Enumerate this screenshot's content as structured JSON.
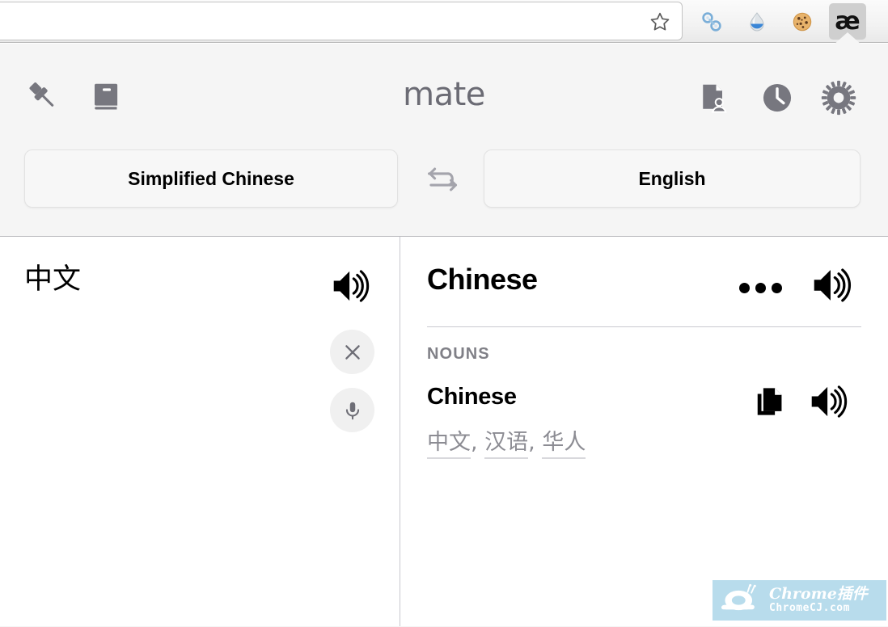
{
  "browser": {
    "omnibox": {
      "value": "",
      "placeholder": ""
    },
    "bookmark_icon": "star-icon",
    "extensions": [
      {
        "name": "link-extension-icon",
        "title": ""
      },
      {
        "name": "water-drop-extension-icon",
        "title": ""
      },
      {
        "name": "cookie-extension-icon",
        "title": ""
      },
      {
        "name": "mate-extension-icon",
        "title": "æ",
        "active": true
      }
    ]
  },
  "popup": {
    "brand": "mate",
    "left_icons": [
      {
        "name": "pin-icon"
      },
      {
        "name": "dictionary-book-icon"
      }
    ],
    "right_icons": [
      {
        "name": "document-person-icon"
      },
      {
        "name": "history-clock-icon"
      },
      {
        "name": "settings-gear-icon"
      }
    ],
    "languages": {
      "source": "Simplified Chinese",
      "target": "English",
      "swap_icon": "swap-arrows-icon"
    },
    "source_panel": {
      "text": "中文",
      "speaker_icon": "speaker-icon",
      "clear_icon": "close-x-icon",
      "mic_icon": "microphone-icon"
    },
    "target_panel": {
      "title": "Chinese",
      "more_icon": "more-dots-icon",
      "speaker_icon": "speaker-icon",
      "part_of_speech": "NOUNS",
      "entry": {
        "word": "Chinese",
        "synonyms": [
          "中文",
          "汉语",
          "华人"
        ],
        "separator": ", ",
        "copy_icon": "copy-icon",
        "speaker_icon": "speaker-icon"
      }
    }
  },
  "watermark": {
    "line1": "Chrome插件",
    "line2": "ChromeCJ.com",
    "logo": "snail-icon",
    "color": "#b8dcec"
  }
}
